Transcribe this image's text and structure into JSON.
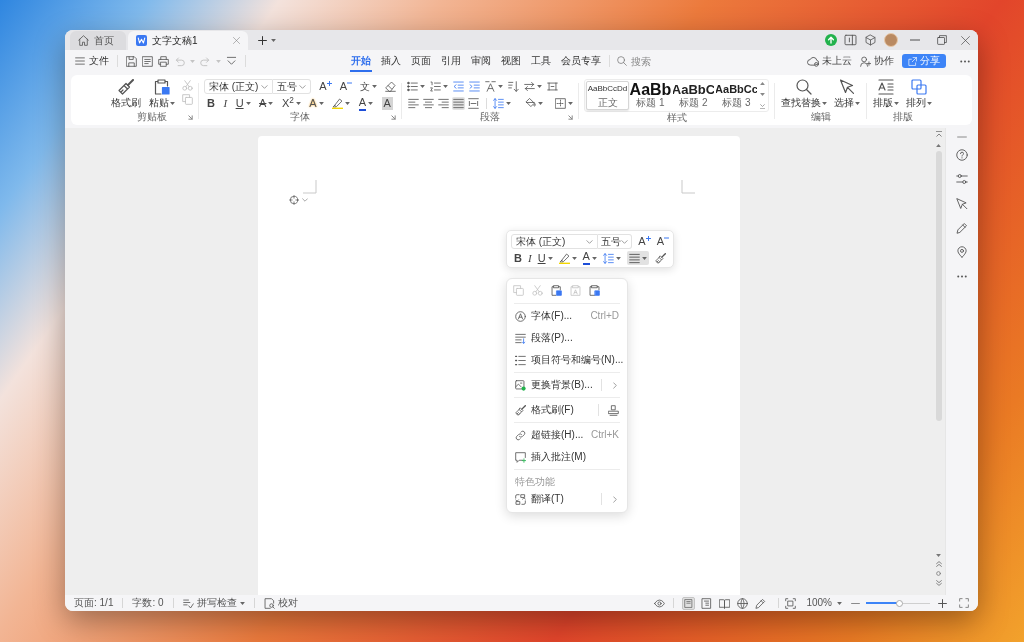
{
  "tabs": [
    {
      "kind": "home",
      "label": "首页",
      "selected": false
    },
    {
      "kind": "document",
      "label": "文字文稿1",
      "selected": true
    }
  ],
  "quick_access": [
    {
      "disabled": false
    },
    {
      "disabled": false
    },
    {
      "disabled": false
    },
    {
      "disabled": true
    },
    {
      "disabled": true
    },
    {
      "disabled": false
    }
  ],
  "menu_bar": {
    "file_menu": "文件",
    "tabs": [
      {
        "label": "开始",
        "selected": true
      },
      {
        "label": "插入",
        "selected": false
      },
      {
        "label": "页面",
        "selected": false
      },
      {
        "label": "引用",
        "selected": false
      },
      {
        "label": "审阅",
        "selected": false
      },
      {
        "label": "视图",
        "selected": false
      },
      {
        "label": "工具",
        "selected": false
      },
      {
        "label": "会员专享",
        "selected": false
      }
    ],
    "search": {
      "placeholder": "搜索"
    },
    "cloud_status": "未上云",
    "collaborate": "协作",
    "share": "分享"
  },
  "ribbon": {
    "clipboard": {
      "title": "剪贴板",
      "format_painter": "格式刷",
      "paste": "粘贴",
      "actions": [
        {
          "disabled": true
        },
        {
          "disabled": true
        }
      ]
    },
    "font": {
      "title": "字体",
      "font_name": "宋体 (正文)",
      "font_size": "五号",
      "grow": "A",
      "shrink": "A",
      "phonetic": "文",
      "format_buttons": [
        {
          "kind": "bold",
          "label": "B"
        },
        {
          "kind": "italic",
          "label": "I"
        },
        {
          "kind": "underline",
          "label": "U"
        },
        {
          "kind": "strikethrough",
          "label": "A"
        },
        {
          "kind": "superscript",
          "label": "X$^{2}$"
        },
        {
          "kind": "effect",
          "label": "A"
        },
        {
          "kind": "highlight"
        },
        {
          "kind": "color",
          "label": "A"
        },
        {
          "kind": "shading",
          "label": "A"
        }
      ]
    },
    "paragraph": {
      "title": "段落",
      "alignments": [
        {
          "selected": false
        },
        {
          "selected": false
        },
        {
          "selected": false
        },
        {
          "selected": true
        },
        {
          "selected": false
        }
      ]
    },
    "styles": {
      "title": "样式",
      "items": [
        {
          "preview": "AaBbCcDd",
          "label": "正文",
          "selected": true
        },
        {
          "preview": "AaBb",
          "label": "标题 1",
          "selected": false
        },
        {
          "preview": "AaBbC",
          "label": "标题 2",
          "selected": false
        },
        {
          "preview": "AaBbCc",
          "label": "标题 3",
          "selected": false
        }
      ]
    },
    "editing": {
      "title": "编辑",
      "find_replace": "查找替换",
      "select": "选择"
    },
    "layout": {
      "title": "排版",
      "typeset": "排版",
      "arrange": "排列"
    }
  },
  "mini_toolbar": {
    "font_name": "宋体 (正文)",
    "font_size": "五号",
    "grow": "A",
    "shrink": "A",
    "format_buttons": [
      {
        "kind": "bold",
        "label": "B"
      },
      {
        "kind": "italic",
        "label": "I"
      },
      {
        "kind": "underline",
        "label": "U"
      },
      {
        "kind": "highlight"
      },
      {
        "kind": "color",
        "label": "A"
      }
    ],
    "align_selected": true
  },
  "context_menu": {
    "clipboard_actions": [
      {
        "disabled": true
      },
      {
        "disabled": true
      },
      {
        "disabled": false
      },
      {
        "disabled": true
      },
      {
        "disabled": false
      }
    ],
    "items": [
      {
        "kind": "item",
        "label": "字体(F)...",
        "shortcut": "Ctrl+D"
      },
      {
        "kind": "item",
        "label": "段落(P)..."
      },
      {
        "kind": "item",
        "label": "项目符号和编号(N)..."
      },
      {
        "kind": "separator"
      },
      {
        "kind": "submenu",
        "label": "更换背景(B)..."
      },
      {
        "kind": "separator"
      },
      {
        "kind": "split",
        "label": "格式刷(F)"
      },
      {
        "kind": "separator"
      },
      {
        "kind": "item",
        "label": "超链接(H)...",
        "shortcut": "Ctrl+K"
      },
      {
        "kind": "item",
        "label": "插入批注(M)"
      },
      {
        "kind": "separator"
      },
      {
        "kind": "heading",
        "label": "特色功能"
      },
      {
        "kind": "submenu",
        "label": "翻译(T)"
      }
    ]
  },
  "status_bar": {
    "page": "页面: 1/1",
    "word_count": "字数: 0",
    "spell_check": "拼写检查",
    "proofread": "校对",
    "view_modes": [
      {
        "selected": true
      },
      {
        "selected": false
      },
      {
        "selected": false
      },
      {
        "selected": false
      },
      {
        "selected": false
      }
    ],
    "zoom": "100%",
    "zoom_slider": {
      "level": 0.52
    }
  }
}
